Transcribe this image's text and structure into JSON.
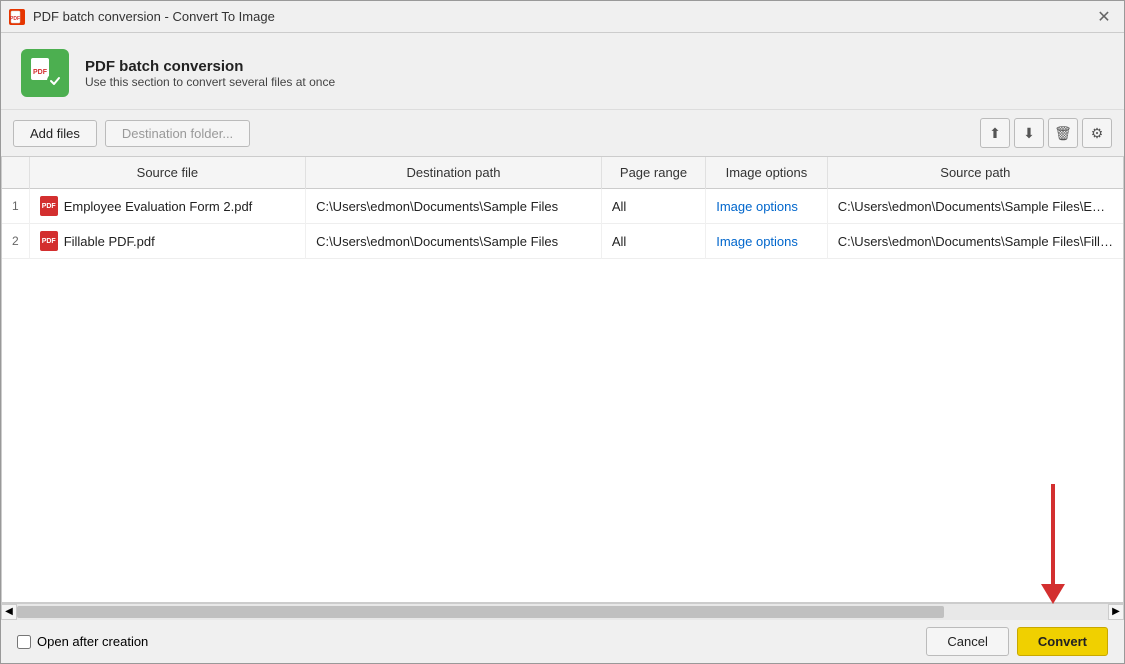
{
  "window": {
    "title": "PDF batch conversion - Convert To Image",
    "close_label": "✕"
  },
  "header": {
    "title": "PDF batch conversion",
    "subtitle": "Use this section to convert several files at once",
    "icon_label": "PDF"
  },
  "toolbar": {
    "add_files_label": "Add files",
    "destination_placeholder": "Destination folder...",
    "move_up_icon": "⬆",
    "download_icon": "⬇",
    "delete_icon": "🗑",
    "settings_icon": "⚙"
  },
  "table": {
    "columns": [
      "Source file",
      "Destination path",
      "Page range",
      "Image options",
      "Source path"
    ],
    "rows": [
      {
        "num": "1",
        "source_file": "Employee Evaluation Form 2.pdf",
        "destination_path": "C:\\Users\\edmon\\Documents\\Sample Files",
        "page_range": "All",
        "image_options": "Image options",
        "source_path": "C:\\Users\\edmon\\Documents\\Sample Files\\Emplo..."
      },
      {
        "num": "2",
        "source_file": "Fillable PDF.pdf",
        "destination_path": "C:\\Users\\edmon\\Documents\\Sample Files",
        "page_range": "All",
        "image_options": "Image options",
        "source_path": "C:\\Users\\edmon\\Documents\\Sample Files\\Fillable..."
      }
    ]
  },
  "footer": {
    "open_after_creation_label": "Open after creation",
    "cancel_label": "Cancel",
    "convert_label": "Convert"
  }
}
